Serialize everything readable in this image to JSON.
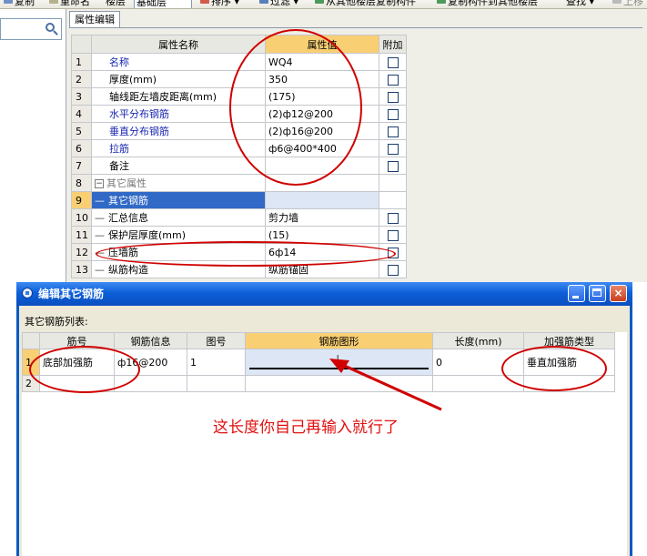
{
  "toolbar": {
    "items": [
      "复制",
      "重命名",
      "楼层",
      "基础层",
      "排序",
      "过滤",
      "从其他楼层复制构件",
      "复制构件到其他楼层",
      "查找",
      "上移"
    ]
  },
  "property_editor": {
    "tab": "属性编辑",
    "headers": [
      "属性名称",
      "属性值",
      "附加"
    ],
    "rows": [
      {
        "num": "1",
        "name": "名称",
        "value": "WQ4",
        "extra": false,
        "style": "blue"
      },
      {
        "num": "2",
        "name": "厚度(mm)",
        "value": "350",
        "extra": true,
        "style": "normal"
      },
      {
        "num": "3",
        "name": "轴线距左墙皮距离(mm)",
        "value": "(175)",
        "extra": true,
        "style": "normal"
      },
      {
        "num": "4",
        "name": "水平分布钢筋",
        "value": "(2)ф12@200",
        "extra": true,
        "style": "blue"
      },
      {
        "num": "5",
        "name": "垂直分布钢筋",
        "value": "(2)ф16@200",
        "extra": true,
        "style": "blue"
      },
      {
        "num": "6",
        "name": "拉筋",
        "value": "ф6@400*400",
        "extra": true,
        "style": "blue"
      },
      {
        "num": "7",
        "name": "备注",
        "value": "",
        "extra": true,
        "style": "normal"
      },
      {
        "num": "8",
        "name": "其它属性",
        "value": "",
        "extra": null,
        "style": "gray",
        "collapse": "−"
      },
      {
        "num": "9",
        "name": "其它钢筋",
        "value": "",
        "extra": null,
        "style": "sel",
        "tree": "—"
      },
      {
        "num": "10",
        "name": "汇总信息",
        "value": "剪力墙",
        "extra": true,
        "style": "normal",
        "tree": "—"
      },
      {
        "num": "11",
        "name": "保护层厚度(mm)",
        "value": "(15)",
        "extra": true,
        "style": "normal",
        "tree": "—"
      },
      {
        "num": "12",
        "name": "压墙筋",
        "value": "6ф14",
        "extra": true,
        "style": "normal",
        "tree": "—"
      },
      {
        "num": "13",
        "name": "纵筋构造",
        "value": "纵筋锚固",
        "extra": true,
        "style": "normal",
        "tree": "—"
      }
    ]
  },
  "dialog": {
    "title": "编辑其它钢筋",
    "list_label": "其它钢筋列表:",
    "buttons": {
      "minimize": "",
      "maximize": "",
      "close": "×"
    },
    "headers": [
      "筋号",
      "钢筋信息",
      "图号",
      "钢筋图形",
      "长度(mm)",
      "加强筋类型"
    ],
    "rows": [
      {
        "num": "1",
        "cells": [
          "底部加强筋",
          "ф16@200",
          "1",
          "",
          "0",
          "垂直加强筋"
        ],
        "shape_mark": "L"
      },
      {
        "num": "2",
        "cells": [
          "",
          "",
          "",
          "",
          "",
          ""
        ],
        "shape_mark": ""
      }
    ]
  },
  "annotation": {
    "text": "这长度你自己再输入就行了",
    "color": "#e01010"
  },
  "colors": {
    "accent": "#f9cf74",
    "selection": "#3169c6",
    "title_bar": "#0a5ac2",
    "annotation": "#d00000"
  }
}
